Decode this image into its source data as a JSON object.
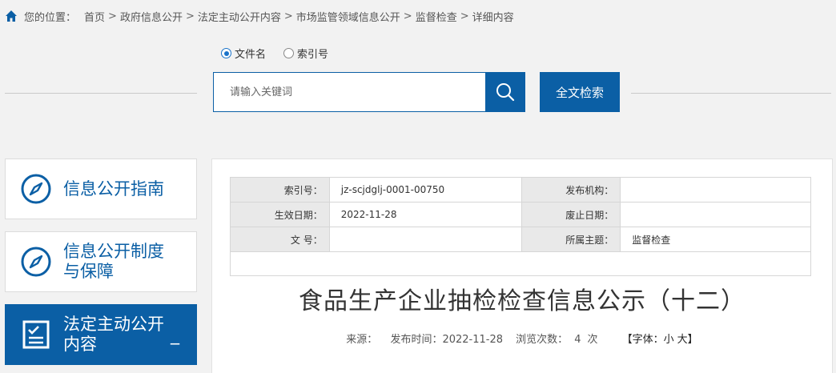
{
  "breadcrumb": {
    "lead": "您的位置：",
    "items": [
      "首页",
      "政府信息公开",
      "法定主动公开内容",
      "市场监管领域信息公开",
      "监督检查",
      "详细内容"
    ],
    "separator": ">"
  },
  "search": {
    "options": [
      "文件名",
      "索引号"
    ],
    "selected": "文件名",
    "placeholder": "请输入关键词",
    "fulltext_label": "全文检索"
  },
  "sidebar": {
    "items": [
      {
        "label": "信息公开指南",
        "icon": "compass-icon",
        "active": false
      },
      {
        "label": "信息公开制度与保障",
        "icon": "compass-icon",
        "active": false
      },
      {
        "label": "法定主动公开内容",
        "icon": "checklist-icon",
        "active": true,
        "toggle": "_"
      }
    ]
  },
  "meta": {
    "rows": [
      {
        "k1": "索引号：",
        "v1": "jz-scjdglj-0001-00750",
        "k2": "发布机构：",
        "v2": ""
      },
      {
        "k1": "生效日期：",
        "v1": "2022-11-28",
        "k2": "废止日期：",
        "v2": ""
      },
      {
        "k1": "文 号：",
        "v1": "",
        "k2": "所属主题：",
        "v2": "监督检查"
      }
    ]
  },
  "article": {
    "title": "食品生产企业抽检检查信息公示（十二）",
    "source_label": "来源：",
    "publish_label": "发布时间：",
    "publish_date": "2022-11-28",
    "views_label": "浏览次数：",
    "views": "4",
    "views_unit": "次",
    "font_open": "【字体：",
    "font_small": "小",
    "font_large": "大",
    "font_close": "】"
  },
  "colors": {
    "accent": "#0b5fa5",
    "background": "#f2f2f2"
  }
}
